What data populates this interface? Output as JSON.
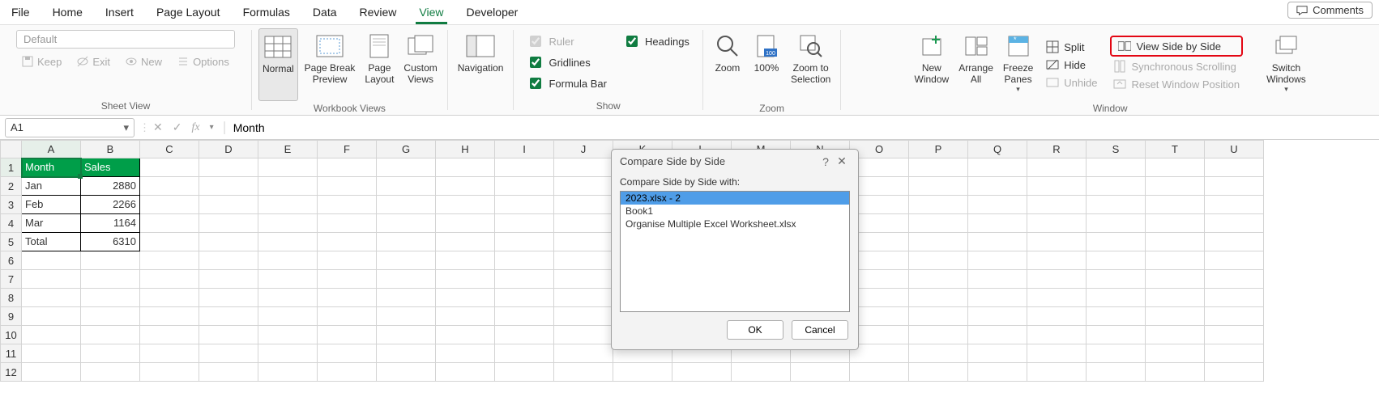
{
  "tabs": [
    "File",
    "Home",
    "Insert",
    "Page Layout",
    "Formulas",
    "Data",
    "Review",
    "View",
    "Developer"
  ],
  "active_tab": "View",
  "comments_label": "Comments",
  "sheetview": {
    "placeholder": "Default",
    "keep": "Keep",
    "exit": "Exit",
    "new": "New",
    "options": "Options",
    "group_label": "Sheet View"
  },
  "workbook_views": {
    "normal": "Normal",
    "pbp": "Page Break\nPreview",
    "pl": "Page\nLayout",
    "cv": "Custom\nViews",
    "group_label": "Workbook Views"
  },
  "nav": {
    "label": "Navigation"
  },
  "show": {
    "ruler": "Ruler",
    "gridlines": "Gridlines",
    "formula_bar": "Formula Bar",
    "headings": "Headings",
    "group_label": "Show"
  },
  "zoom": {
    "zoom": "Zoom",
    "hundred": "100%",
    "zts": "Zoom to\nSelection",
    "group_label": "Zoom"
  },
  "window": {
    "new_window": "New\nWindow",
    "arrange_all": "Arrange\nAll",
    "freeze": "Freeze\nPanes",
    "split": "Split",
    "hide": "Hide",
    "unhide": "Unhide",
    "view_sbs": "View Side by Side",
    "sync_scroll": "Synchronous Scrolling",
    "reset_pos": "Reset Window Position",
    "switch": "Switch\nWindows",
    "group_label": "Window"
  },
  "namebox": "A1",
  "formula": "Month",
  "columns": [
    "A",
    "B",
    "C",
    "D",
    "E",
    "F",
    "G",
    "H",
    "I",
    "J",
    "K",
    "L",
    "M",
    "N",
    "O",
    "P",
    "Q",
    "R",
    "S",
    "T",
    "U"
  ],
  "rows": 12,
  "data": {
    "h1": "Month",
    "h2": "Sales",
    "r1a": "Jan",
    "r1b": "2880",
    "r2a": "Feb",
    "r2b": "2266",
    "r3a": "Mar",
    "r3b": "1164",
    "r4a": "Total",
    "r4b": "6310"
  },
  "dialog": {
    "title": "Compare Side by Side",
    "label": "Compare Side by Side with:",
    "items": [
      "2023.xlsx  -  2",
      "Book1",
      "Organise Multiple Excel Worksheet.xlsx"
    ],
    "ok": "OK",
    "cancel": "Cancel"
  }
}
